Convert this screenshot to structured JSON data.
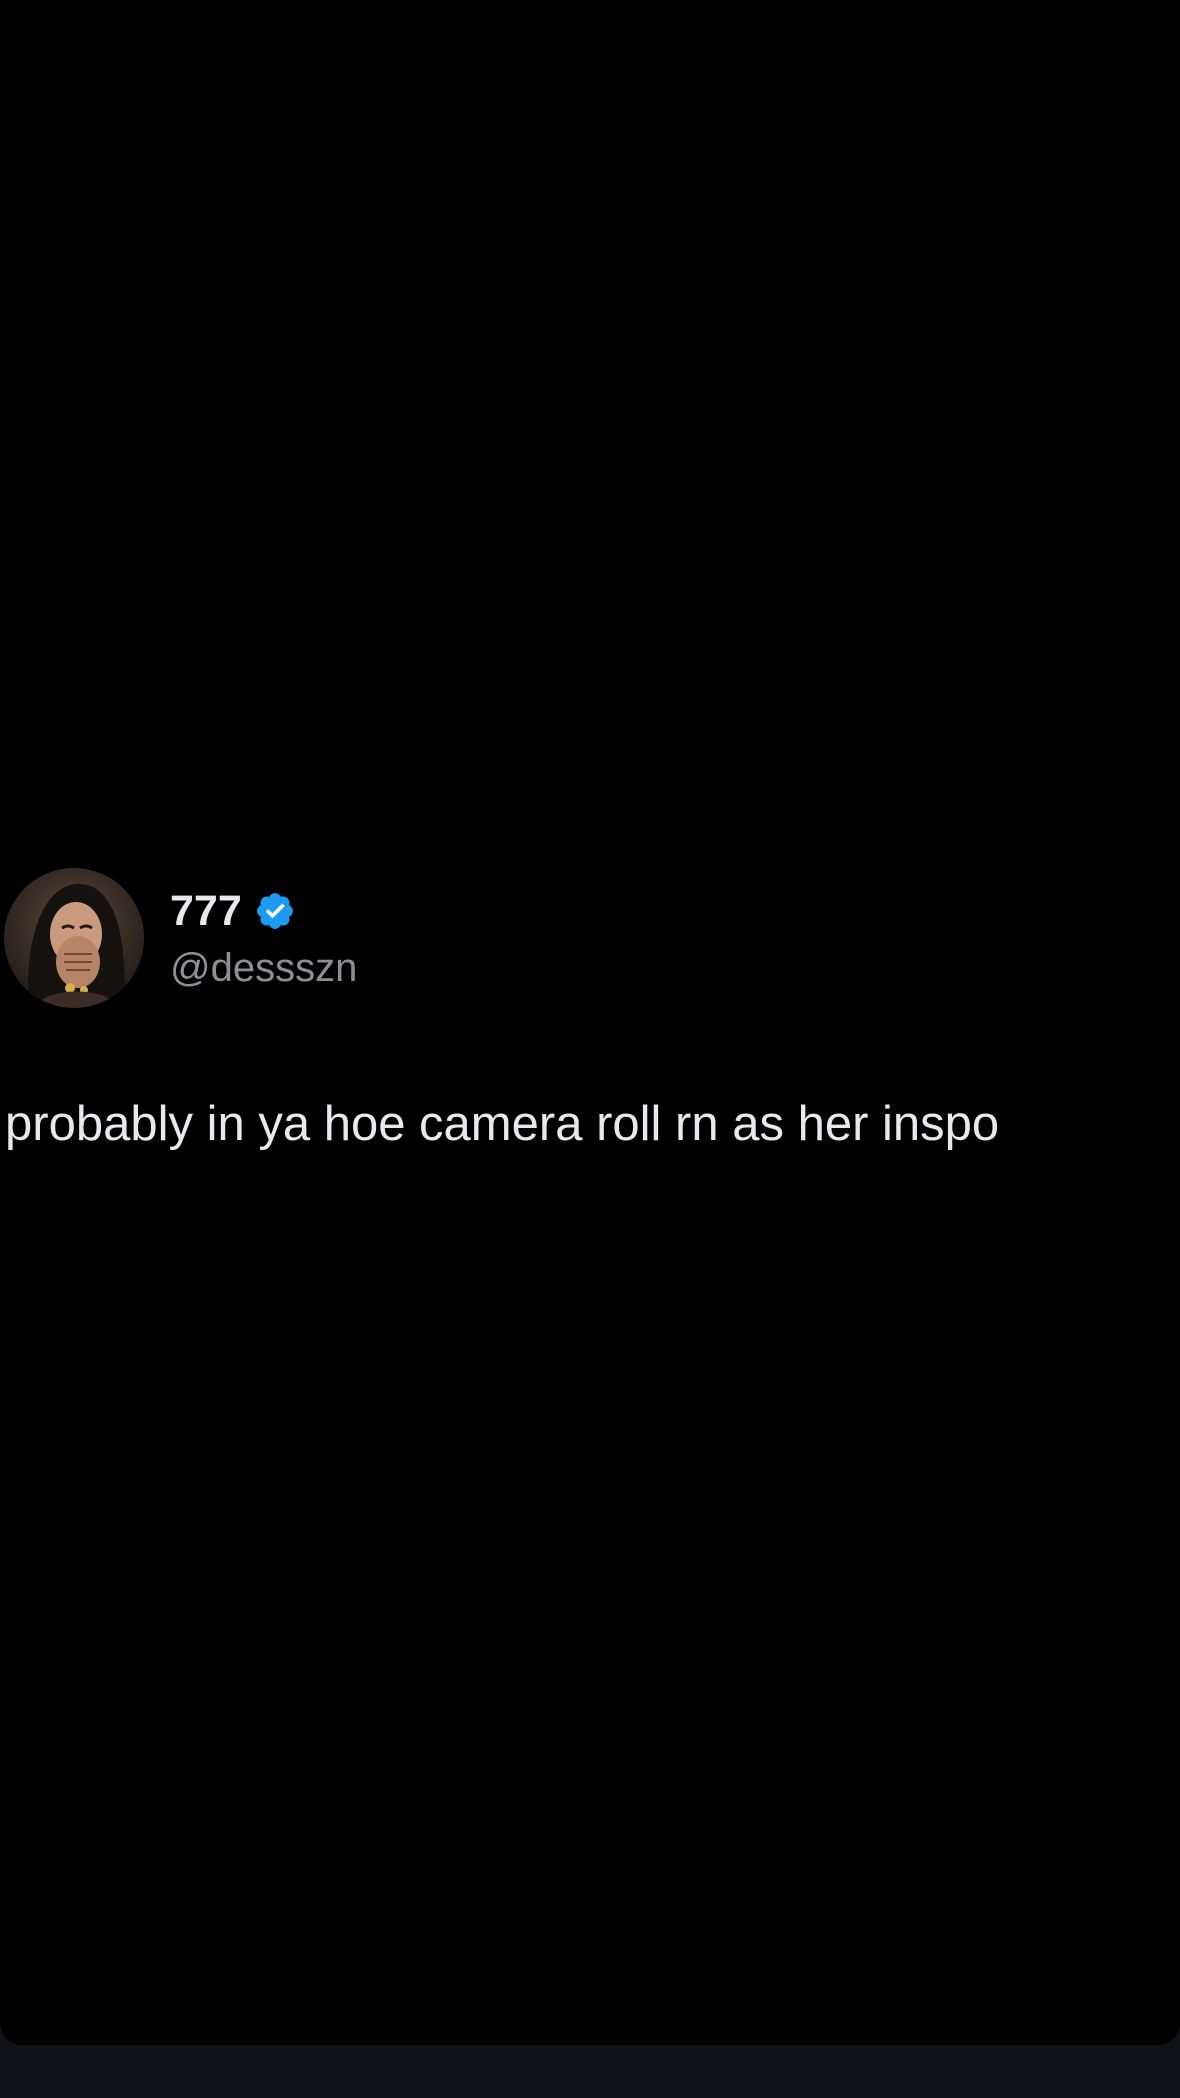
{
  "tweet": {
    "author": {
      "display_name": "777",
      "handle": "@dessszn",
      "verified": true,
      "verified_color": "#1d9bf0",
      "avatar_icon": "profile-photo"
    },
    "text": "probably in ya hoe camera roll rn as her inspo"
  },
  "colors": {
    "background": "#000000",
    "text_primary": "#e7e9ea",
    "text_secondary": "#8b9096"
  }
}
